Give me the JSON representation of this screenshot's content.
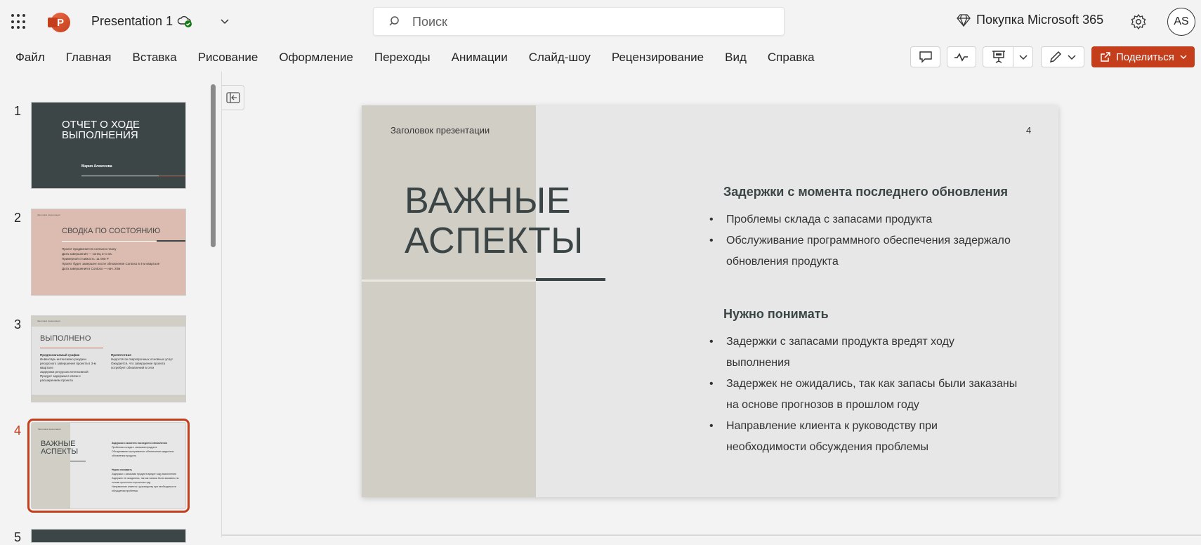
{
  "app": {
    "doc_title": "Presentation 1",
    "search_placeholder": "Поиск",
    "buy_label": "Покупка Microsoft 365",
    "avatar_initials": "AS",
    "share_label": "Поделиться",
    "accent_color": "#c43e1c"
  },
  "menu": [
    "Файл",
    "Главная",
    "Вставка",
    "Рисование",
    "Оформление",
    "Переходы",
    "Анимации",
    "Слайд-шоу",
    "Рецензирование",
    "Вид",
    "Справка"
  ],
  "thumbnails": [
    {
      "num": "1",
      "title": "ОТЧЕТ О ХОДЕ ВЫПОЛНЕНИЯ",
      "author": "Мария Алексеева"
    },
    {
      "num": "2",
      "header": "Заголовок презентации",
      "title": "СВОДКА ПО СОСТОЯНИЮ",
      "lines": [
        "Проект продвигается согласно плану",
        "Дата завершения — конец 3-го кв.",
        "Примерная стоимость: 11 000 Р",
        "Проект будет завершен после обновления Contoso в 4-м квартале",
        "Дата завершения в Contoso — нач. 20м"
      ]
    },
    {
      "num": "3",
      "header": "Заголовок презентации",
      "title": "ВЫПОЛНЕНО",
      "col1_title": "Предполагаемый график",
      "col1_lines": [
        "Инвентарь интенсивно раздачи ресурсного завершения проекта в 3-м квартале",
        "Задержки ресурсов интенсивной Продукт задержки в связи с расширением проекта"
      ],
      "col2_title": "Препятствия",
      "col2_lines": [
        "Недостаток сверхпрочных основных услуг",
        "Ожидается, что завершение проекта потребует обновлений в сети"
      ]
    },
    {
      "num": "4",
      "header": "Заголовок презентации",
      "title": "ВАЖНЫЕ АСПЕКТЫ"
    },
    {
      "num": "5"
    }
  ],
  "slide": {
    "presentation_title": "Заголовок презентации",
    "page_number": "4",
    "heading_line1": "ВАЖНЫЕ",
    "heading_line2": "АСПЕКТЫ",
    "section1_title": "Задержки с момента последнего обновления",
    "section1_bullets": [
      "Проблемы склада с запасами продукта",
      "Обслуживание программного обеспечения задержало обновления продукта"
    ],
    "section2_title": "Нужно понимать",
    "section2_bullets": [
      "Задержки с запасами продукта вредят ходу выполнения",
      "Задержек не ожидались, так как запасы были заказаны на основе прогнозов в прошлом году",
      "Направление клиента к руководству при необходимости обсуждения проблемы"
    ]
  }
}
